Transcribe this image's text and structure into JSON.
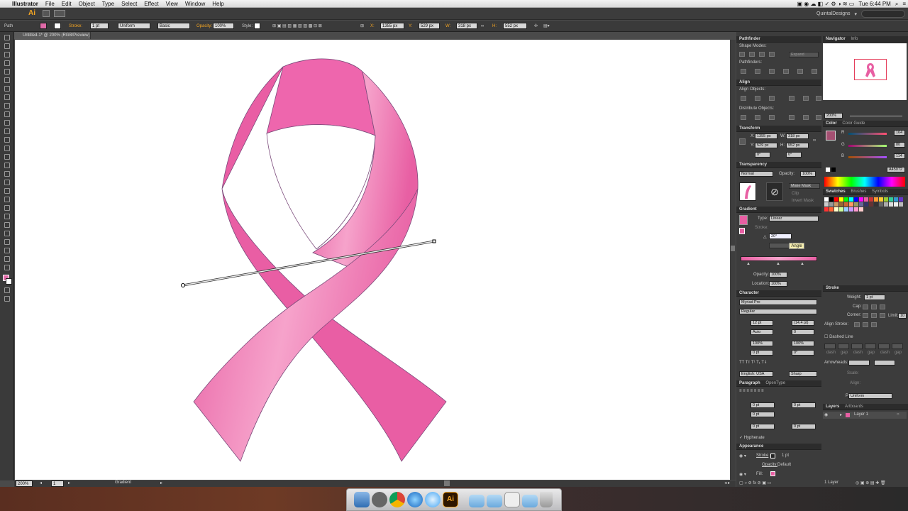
{
  "mac_menu": {
    "apple": "",
    "app": "Illustrator",
    "items": [
      "File",
      "Edit",
      "Object",
      "Type",
      "Select",
      "Effect",
      "View",
      "Window",
      "Help"
    ],
    "clock": "Tue 6:44 PM"
  },
  "appbar": {
    "logo": "Ai",
    "workspace": "QuintalDesigns"
  },
  "control": {
    "selection": "Path",
    "stroke_label": "Stroke:",
    "stroke_weight": "1 pt",
    "profile": "Uniform",
    "brush": "Basic",
    "opacity_label": "Opacity:",
    "opacity": "100%",
    "style_label": "Style:",
    "x_label": "X:",
    "x": "1355 px",
    "y_label": "Y:",
    "y": "529 px",
    "w_label": "W:",
    "w": "318 px",
    "h_label": "H:",
    "h": "552 px"
  },
  "document": {
    "tab": "Untitled-1* @ 200% (RGB/Preview)",
    "zoom": "200%",
    "page": "1",
    "status": "Gradient"
  },
  "panels": {
    "pathfinder": {
      "title": "Pathfinder",
      "shape_modes": "Shape Modes:",
      "expand": "Expand",
      "pathfinders": "Pathfinders:"
    },
    "align": {
      "title": "Align",
      "align_objects": "Align Objects:",
      "distribute_objects": "Distribute Objects:"
    },
    "transform": {
      "title": "Transform",
      "x_label": "X:",
      "x": "1355 px",
      "y_label": "Y:",
      "y": "529 px",
      "w_label": "W:",
      "w": "318 px",
      "h_label": "H:",
      "h": "552 px",
      "rot": "0°",
      "shear": "0°"
    },
    "transparency": {
      "title": "Transparency",
      "mode": "Normal",
      "opacity_label": "Opacity:",
      "opacity": "100%",
      "make_mask": "Make Mask",
      "clip": "Clip",
      "invert": "Invert Mask"
    },
    "gradient": {
      "title": "Gradient",
      "type_label": "Type:",
      "type": "Linear",
      "stroke_label": "Stroke:",
      "angle": "20°",
      "tooltip": "Angle",
      "opacity_label": "Opacity:",
      "opacity": "100%",
      "location_label": "Location:",
      "location": "100%"
    },
    "character": {
      "title": "Character",
      "font": "Myriad Pro",
      "style": "Regular",
      "size": "12 pt",
      "leading": "(14.4 pt)",
      "kerning": "Auto",
      "tracking": "0",
      "vscale": "100%",
      "hscale": "100%",
      "baseline": "0 pt",
      "rotation": "0°",
      "language": "English: USA",
      "aa": "Sharp"
    },
    "paragraph": {
      "title": "Paragraph",
      "tab2": "OpenType",
      "v1": "0 pt",
      "v2": "0 pt",
      "v3": "0 pt",
      "v4": "0 pt",
      "v5": "0 pt",
      "hyphenate": "Hyphenate"
    },
    "appearance": {
      "title": "Appearance",
      "stroke_label": "Stroke",
      "stroke_val": "1 pt",
      "opacity_label": "Opacity:",
      "opacity_val": "Default",
      "fill_label": "Fill:"
    },
    "navigator": {
      "title": "Navigator",
      "tab2": "Info",
      "zoom": "200%"
    },
    "color": {
      "title": "Color",
      "tab2": "Color Guide",
      "r": "164",
      "g": "80",
      "b": "114",
      "hex": "A45072"
    },
    "swatches": {
      "title": "Swatches",
      "tab2": "Brushes",
      "tab3": "Symbols"
    },
    "stroke": {
      "title": "Stroke",
      "weight_label": "Weight:",
      "weight": "1 pt",
      "cap_label": "Cap:",
      "corner_label": "Corner:",
      "limit_label": "Limit:",
      "limit": "10",
      "align_label": "Align Stroke:",
      "dashed": "Dashed Line",
      "dash_labels": [
        "dash",
        "gap",
        "dash",
        "gap",
        "dash",
        "gap"
      ],
      "arrowheads": "Arrowheads:",
      "scale": "Scale:",
      "align2": "Align:",
      "profile_label": "Profile:",
      "profile": "Uniform"
    },
    "layers": {
      "title": "Layers",
      "tab2": "Artboards",
      "layer1": "Layer 1",
      "count": "1 Layer"
    }
  },
  "colors": {
    "ribbon": "#e85fa3",
    "ribbon_highlight": "#f59ac8",
    "fill_swatch": "#e16aa8",
    "accent": "#f5a623"
  },
  "icons": [
    "apple-icon",
    "finder-icon",
    "safari-icon",
    "chrome-icon",
    "itunes-icon",
    "messages-icon",
    "illustrator-icon",
    "folder-icon",
    "trash-icon"
  ]
}
